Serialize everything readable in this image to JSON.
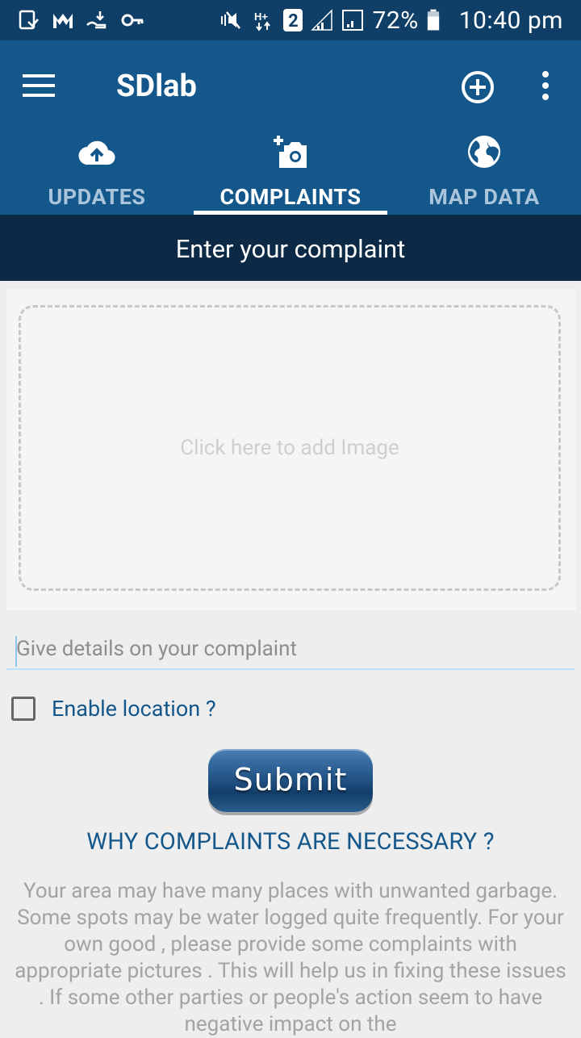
{
  "status_bar": {
    "battery_percent": "72%",
    "time": "10:40 pm",
    "sim_label": "2",
    "icons": [
      "screenshot-icon",
      "gmail-like-icon",
      "download-hand-icon",
      "key-icon",
      "mute-vibrate-icon",
      "hplus-data-icon",
      "sim2-icon",
      "signal-icon",
      "signal-icon",
      "battery-icon"
    ]
  },
  "app_bar": {
    "title": "SDlab",
    "menu_icon": "hamburger-menu-icon",
    "add_icon": "add-circle-icon",
    "more_icon": "more-vert-icon"
  },
  "tabs": [
    {
      "label": "UPDATES",
      "icon": "cloud-upload-icon",
      "active": false
    },
    {
      "label": "COMPLAINTS",
      "icon": "add-photo-camera-icon",
      "active": true
    },
    {
      "label": "MAP DATA",
      "icon": "globe-icon",
      "active": false
    }
  ],
  "header": {
    "title": "Enter your complaint"
  },
  "image_picker": {
    "label": "Click here to add Image"
  },
  "details": {
    "placeholder": "Give details on your complaint",
    "value": ""
  },
  "location": {
    "label": "Enable location ?",
    "checked": false
  },
  "submit": {
    "label": "Submit"
  },
  "info": {
    "heading": "WHY COMPLAINTS ARE NECESSARY ?",
    "body": "Your area may have many places with unwanted garbage. Some spots may be water logged quite frequently. For your own good , please provide some complaints with appropriate pictures . This will help us in fixing these issues . If some other parties or people's action seem to have negative impact on the"
  },
  "colors": {
    "status_bar": "#0f3f66",
    "app_bar": "#14578b",
    "header": "#0c2a45",
    "accent_text": "#14578b"
  }
}
